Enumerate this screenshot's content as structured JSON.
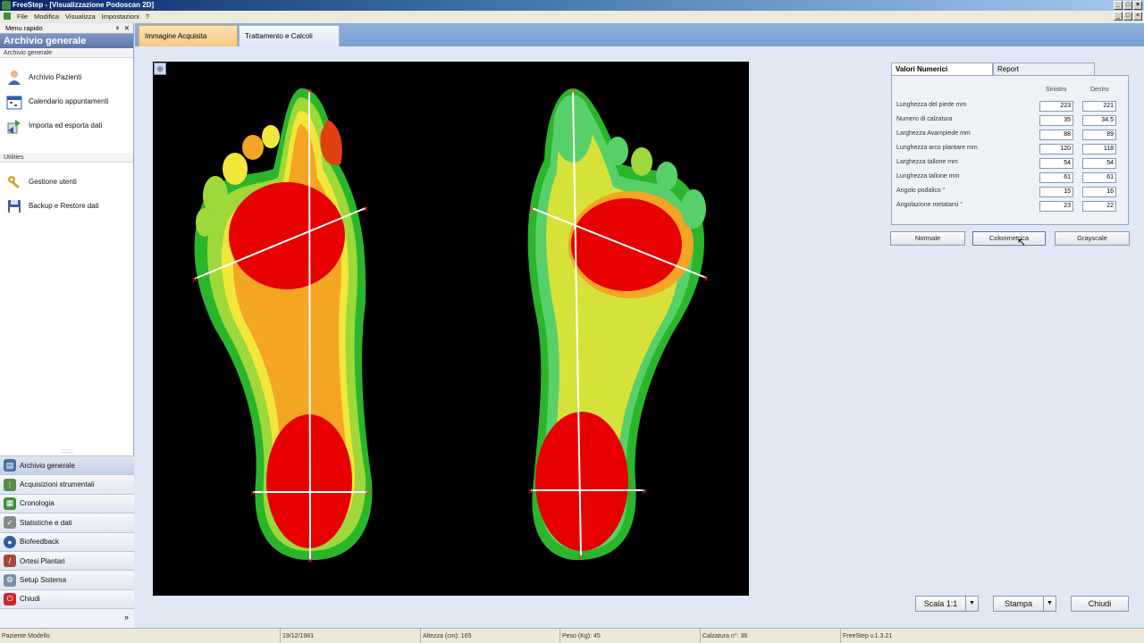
{
  "window": {
    "title": "FreeStep - [Visualizzazione Podoscan 2D]",
    "controls": [
      "_",
      "□",
      "×"
    ]
  },
  "menu": [
    "File",
    "Modifica",
    "Visualizza",
    "Impostazioni",
    "?"
  ],
  "sidebar": {
    "header": "Menu rapido",
    "pin": "ᵠ",
    "close": "✕",
    "title": "Archivio generale",
    "section1": "Archivio generale",
    "items1": [
      {
        "label": "Archivio Pazienti",
        "icon": "patient-icon"
      },
      {
        "label": "Calendario appuntamenti",
        "icon": "calendar-icon"
      },
      {
        "label": "Importa ed esporta dati",
        "icon": "import-export-icon"
      }
    ],
    "section2": "Utilities",
    "items2": [
      {
        "label": "Gestione utenti",
        "icon": "users-keys-icon"
      },
      {
        "label": "Backup e Restore dati",
        "icon": "backup-icon"
      }
    ],
    "splitter": "::::::::",
    "nav": [
      {
        "label": "Archivio generale",
        "icon": "archive-icon",
        "color": "#4a6fa5"
      },
      {
        "label": "Acquisizioni strumentali",
        "icon": "footprints-icon",
        "color": "#5a8b4a"
      },
      {
        "label": "Cronologia",
        "icon": "chronology-icon",
        "color": "#3c8d3c"
      },
      {
        "label": "Statistiche e dati",
        "icon": "statistics-icon",
        "color": "#8a8a8a"
      },
      {
        "label": "Biofeedback",
        "icon": "biofeedback-icon",
        "color": "#2f5fa8"
      },
      {
        "label": "Ortesi Plantari",
        "icon": "orthotics-icon",
        "color": "#a34a3a"
      },
      {
        "label": "Setup Sistema",
        "icon": "setup-icon",
        "color": "#7a8fa8"
      },
      {
        "label": "Chiudi",
        "icon": "close-app-icon",
        "color": "#c62828"
      }
    ],
    "footer_chevron": "»"
  },
  "tabs": [
    "Immagine Acquisita",
    "Trattamento e Calcoli"
  ],
  "image": {
    "zoom_glyph": "⊕"
  },
  "values_panel": {
    "tabs": [
      "Valori Numerici",
      "Report"
    ],
    "col_left": "Sinistro",
    "col_right": "Destro",
    "rows": [
      {
        "label": "Lunghezza del piede mm",
        "left": "223",
        "right": "221"
      },
      {
        "label": "Numero di calzatura",
        "left": "35",
        "right": "34.5"
      },
      {
        "label": "Larghezza Avampiede mm",
        "left": "88",
        "right": "89"
      },
      {
        "label": "Lunghezza arco plantare mm",
        "left": "120",
        "right": "118"
      },
      {
        "label": "Larghezza tallone mm",
        "left": "54",
        "right": "54"
      },
      {
        "label": "Lunghezza tallone mm",
        "left": "61",
        "right": "61"
      },
      {
        "label": "Angolo podalico °",
        "left": "15",
        "right": "16"
      },
      {
        "label": "Angolazione metatarsi °",
        "left": "23",
        "right": "22"
      }
    ],
    "buttons": [
      "Normale",
      "Colorimetrica",
      "Grayscale"
    ]
  },
  "bottom_buttons": {
    "scale": "Scala 1:1",
    "print": "Stampa",
    "close": "Chiudi",
    "drop": "▼"
  },
  "status": [
    "Paziente Modello",
    "19/12/1981",
    "Altezza (cm): 165",
    "Peso (Kg): 45",
    "Calzatura n°: 36",
    "FreeStep v.1.3.21"
  ]
}
